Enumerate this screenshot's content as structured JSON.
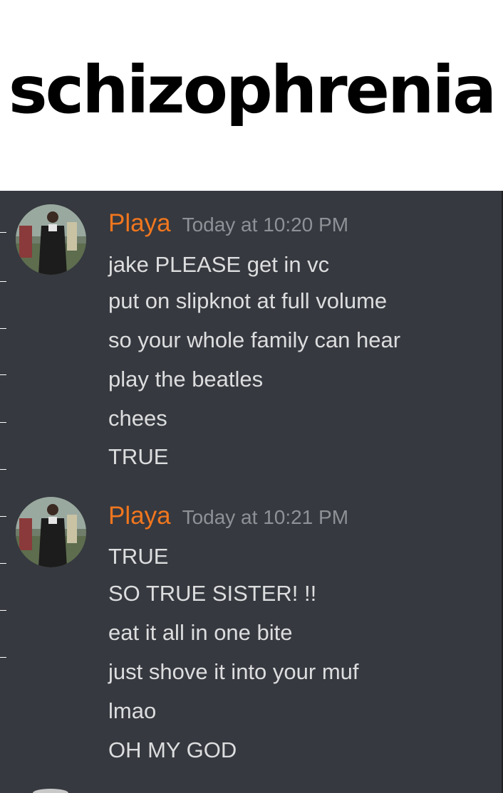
{
  "title": "schizophrenia",
  "messages": [
    {
      "username": "Playa",
      "timestamp": "Today at 10:20 PM",
      "avatar_icon": "user-avatar-photo",
      "lines": [
        "jake PLEASE get in vc",
        "put on slipknot at full volume",
        "so your whole family can hear",
        "play the beatles",
        "chees",
        "TRUE"
      ]
    },
    {
      "username": "Playa",
      "timestamp": "Today at 10:21 PM",
      "avatar_icon": "user-avatar-photo",
      "lines": [
        "TRUE",
        "SO TRUE SISTER! !!",
        "eat it all in one bite",
        "just shove it into your muf",
        "lmao",
        "OH MY GOD"
      ]
    }
  ],
  "colors": {
    "chat_background": "#36393f",
    "username": "#f1761e",
    "timestamp": "#8e9297",
    "message_text": "#dcddde"
  }
}
